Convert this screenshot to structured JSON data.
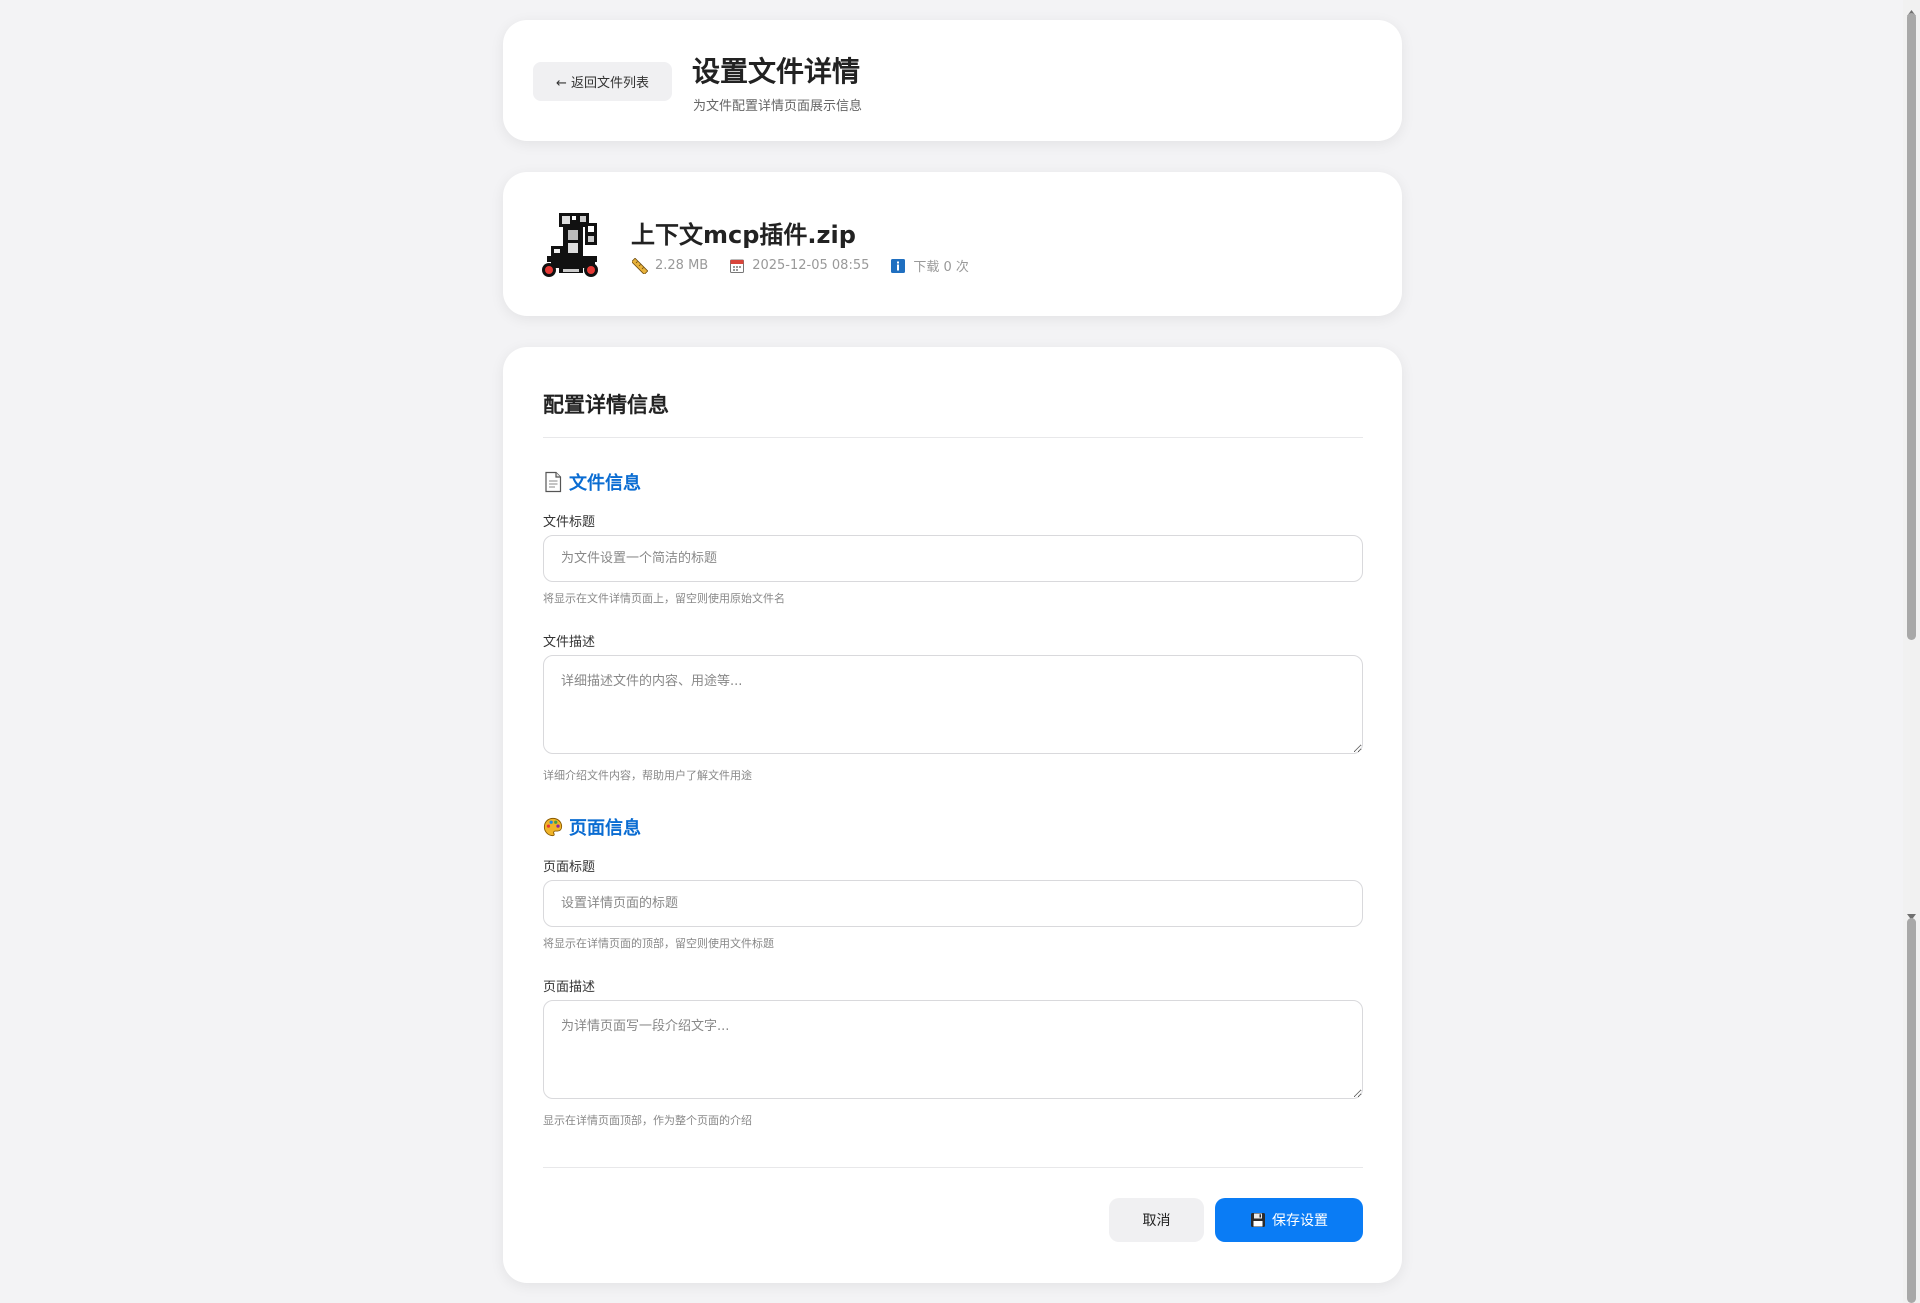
{
  "header": {
    "back_label": "← 返回文件列表",
    "title": "设置文件详情",
    "subtitle": "为文件配置详情页面展示信息"
  },
  "file": {
    "name": "上下文mcp插件.zip",
    "size": "2.28 MB",
    "date": "2025-12-05 08:55",
    "downloads": "下载 0 次",
    "icons": {
      "type": "zip-robot-icon",
      "size": "ruler-icon",
      "date": "calendar-icon",
      "downloads": "info-icon"
    }
  },
  "form": {
    "title": "配置详情信息",
    "file_section": {
      "icon": "document-icon",
      "title": "文件信息",
      "title_field": {
        "label": "文件标题",
        "value": "",
        "placeholder": "为文件设置一个简洁的标题",
        "hint": "将显示在文件详情页面上，留空则使用原始文件名"
      },
      "desc_field": {
        "label": "文件描述",
        "value": "",
        "placeholder": "详细描述文件的内容、用途等...",
        "hint": "详细介绍文件内容，帮助用户了解文件用途"
      }
    },
    "page_section": {
      "icon": "palette-icon",
      "title": "页面信息",
      "title_field": {
        "label": "页面标题",
        "value": "",
        "placeholder": "设置详情页面的标题",
        "hint": "将显示在详情页面的顶部，留空则使用文件标题"
      },
      "desc_field": {
        "label": "页面描述",
        "value": "",
        "placeholder": "为详情页面写一段介绍文字...",
        "hint": "显示在详情页面顶部，作为整个页面的介绍"
      }
    },
    "cancel_label": "取消",
    "save_label": "保存设置"
  },
  "colors": {
    "accent": "#0a7cf5",
    "section_title": "#0a6cd2",
    "background": "#f3f3f5"
  }
}
